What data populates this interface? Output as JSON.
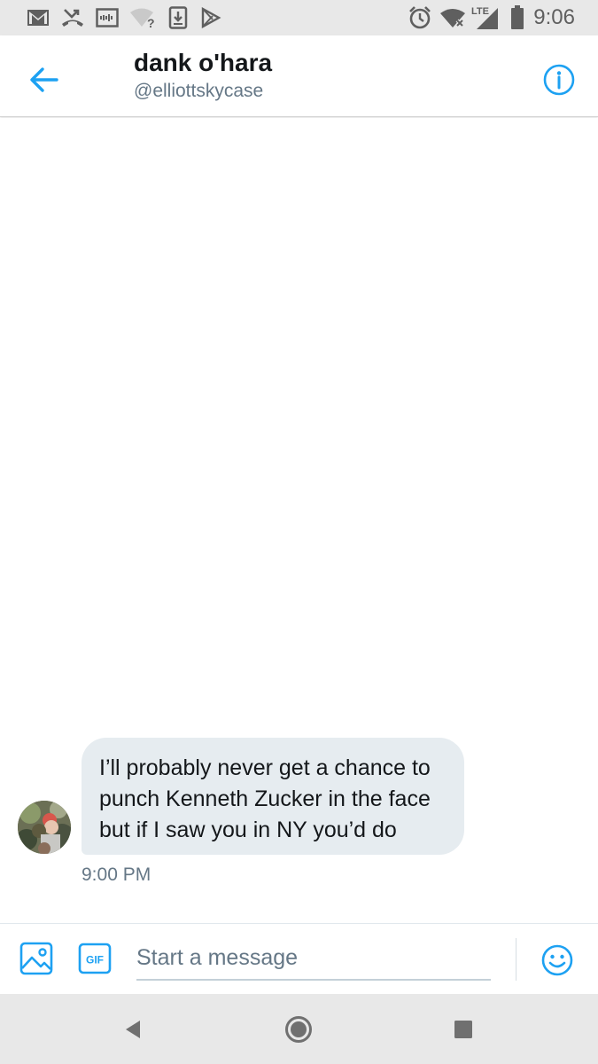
{
  "status_bar": {
    "time": "9:06",
    "network": "LTE",
    "wifi_badge": "?",
    "icons": [
      "gmail-icon",
      "missed-call-icon",
      "voicemail-icon",
      "wifi-unknown-icon",
      "download-icon",
      "play-store-icon",
      "alarm-icon",
      "wifi-icon",
      "signal-icon",
      "battery-icon"
    ]
  },
  "header": {
    "title": "dank o'hara",
    "handle": "@elliottskycase",
    "back_icon": "arrow-left-icon",
    "info_icon": "info-icon"
  },
  "conversation": {
    "messages": [
      {
        "text": "I’ll probably never get a chance to punch Kenneth Zucker in the face but if I saw you in NY you’d do",
        "time": "9:00 PM"
      }
    ]
  },
  "composer": {
    "placeholder": "Start a message",
    "value": "",
    "gif_label": "GIF",
    "media_icon": "image-icon",
    "emoji_icon": "emoji-icon"
  },
  "nav_bar": {
    "icons": [
      "back-triangle-icon",
      "home-circle-icon",
      "recents-square-icon"
    ]
  },
  "colors": {
    "accent": "#1da1f2",
    "bubble": "#e6ecf0",
    "secondary_text": "#657786",
    "primary_text": "#14171a",
    "system_bar": "#e8e8e8",
    "system_icon": "#5f5f5f"
  }
}
